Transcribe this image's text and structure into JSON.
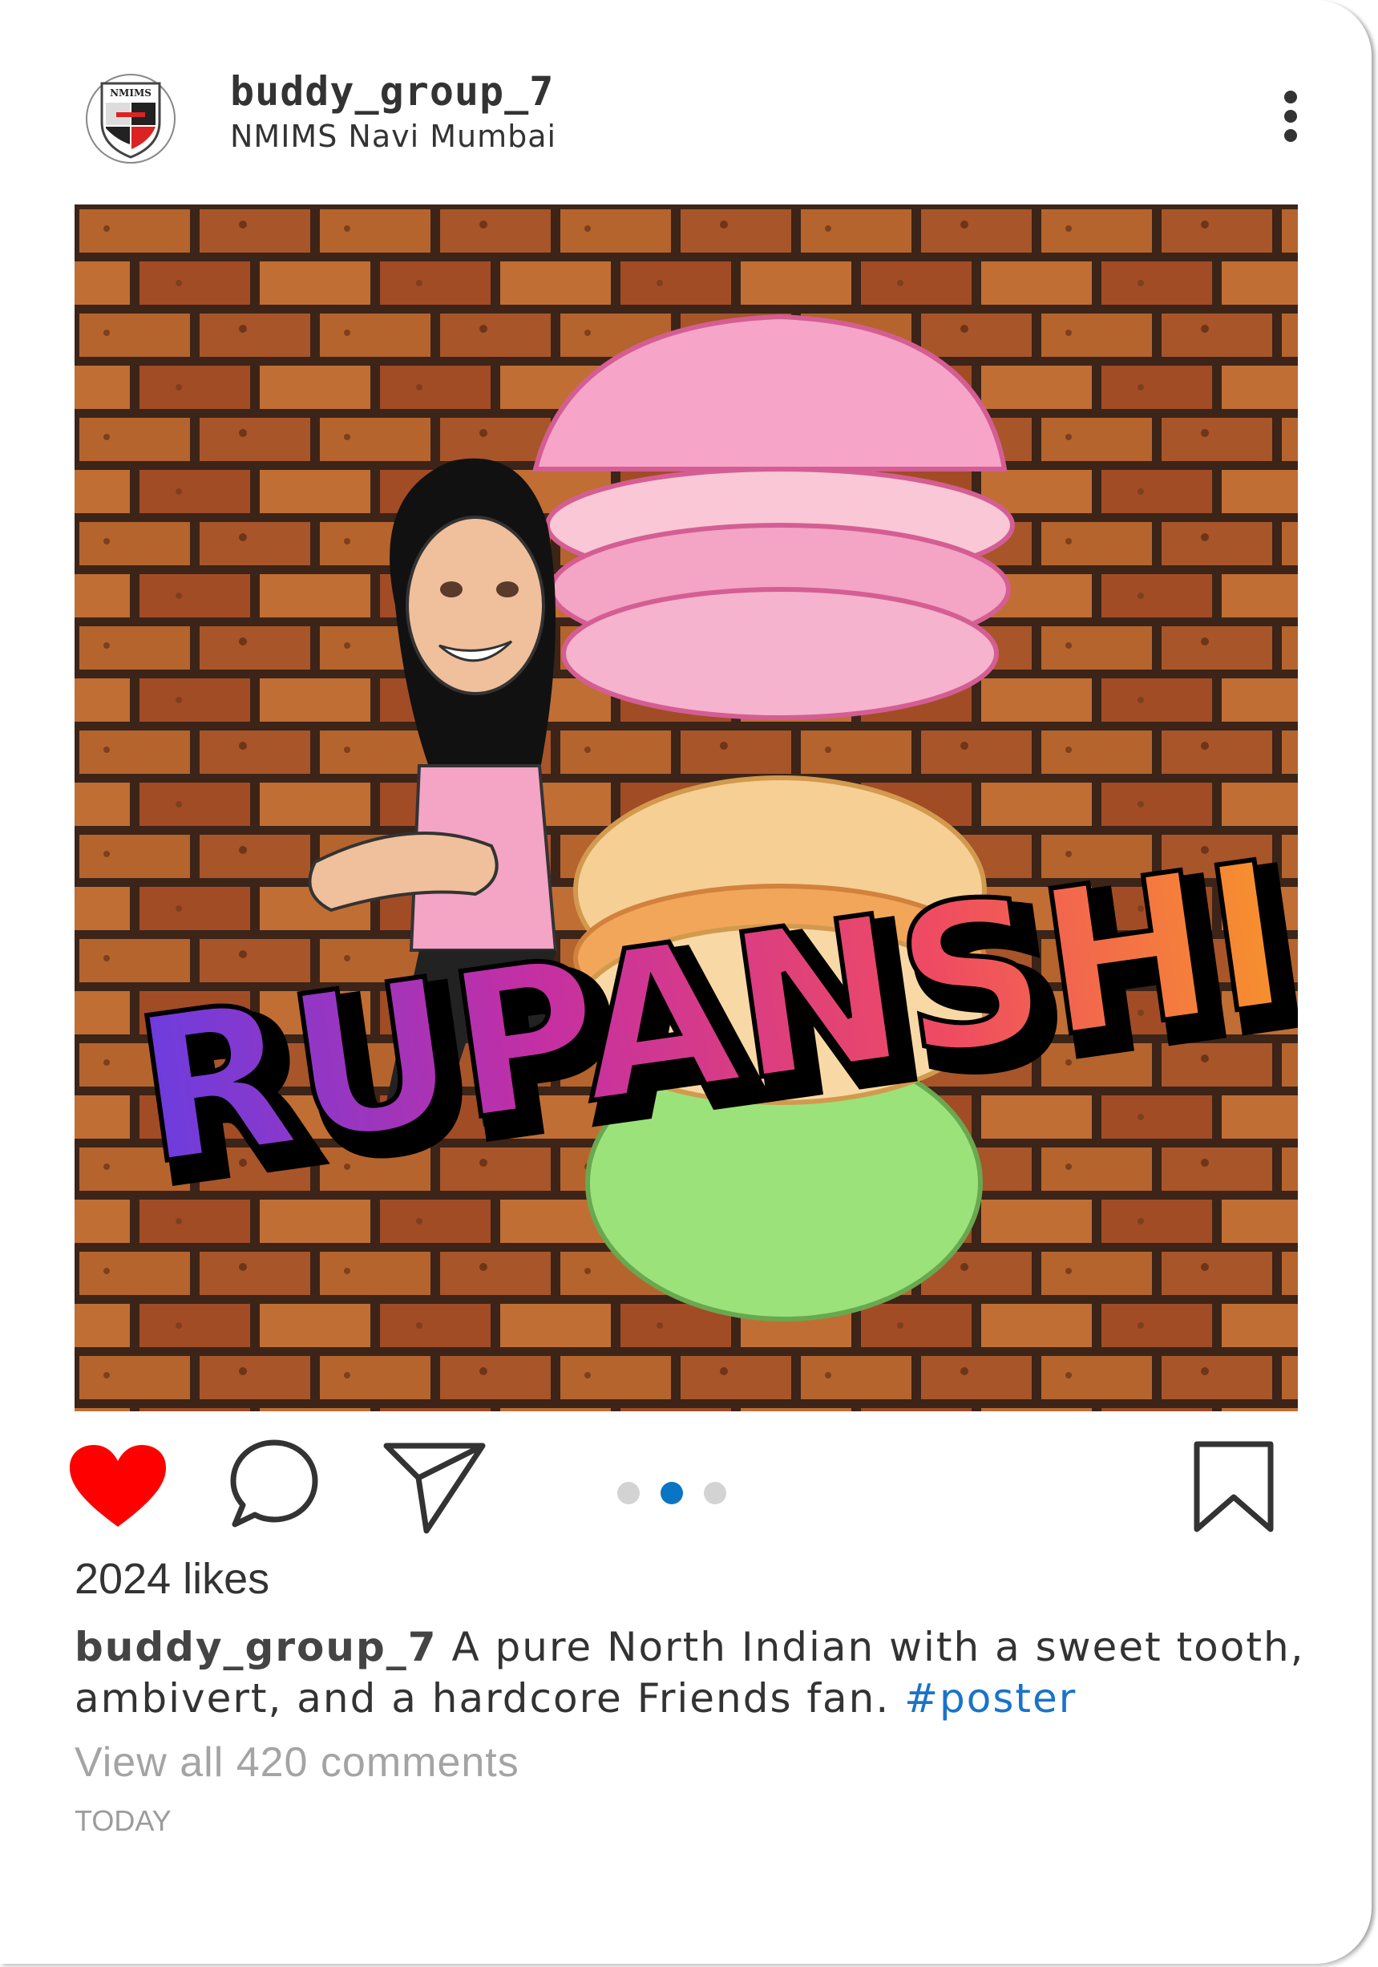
{
  "post": {
    "username": "buddy_group_7",
    "location": "NMIMS Navi Mumbai",
    "logo": {
      "label": "NMIMS",
      "icon": "nmims-shield-logo"
    },
    "image": {
      "overlay_text": "RUPANSHI",
      "description_icon": "bitmoji-with-macarons-on-brick-wall"
    },
    "actions": {
      "like": {
        "icon": "heart-icon",
        "liked": true,
        "color": "#ff0000"
      },
      "comment": {
        "icon": "comment-bubble-icon"
      },
      "share": {
        "icon": "paper-plane-icon"
      },
      "save": {
        "icon": "bookmark-icon"
      }
    },
    "carousel": {
      "total": 3,
      "active_index": 1,
      "active_color": "#0a74c5",
      "inactive_color": "#d3d3d3"
    },
    "likes_text": "2024 likes",
    "caption": {
      "username": "buddy_group_7",
      "text": " A pure North Indian with a sweet tooth, ambivert, and a hardcore Friends fan. ",
      "hashtag": "#poster"
    },
    "view_comments": "View all 420 comments",
    "timestamp": "TODAY"
  }
}
